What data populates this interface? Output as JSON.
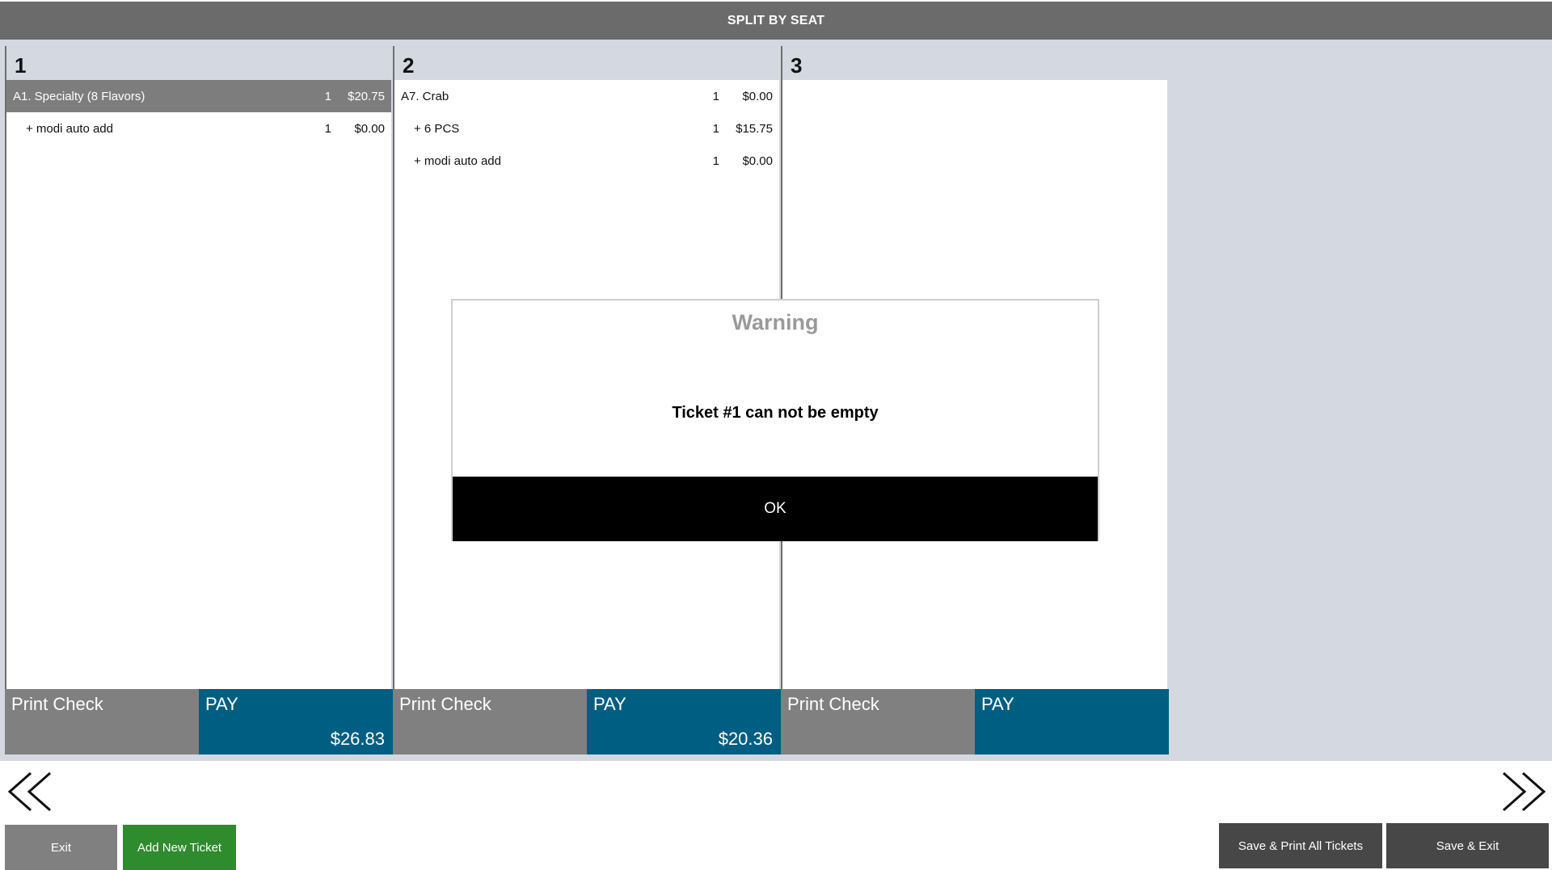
{
  "header": {
    "title": "SPLIT BY SEAT"
  },
  "tickets": [
    {
      "number": "1",
      "items": [
        {
          "name": "A1. Specialty (8 Flavors)",
          "qty": "1",
          "price": "$20.75",
          "selected": true,
          "modifier": false
        },
        {
          "name": "+ modi auto add",
          "qty": "1",
          "price": "$0.00",
          "selected": false,
          "modifier": true
        }
      ],
      "print_label": "Print Check",
      "pay_label": "PAY",
      "pay_total": "$26.83"
    },
    {
      "number": "2",
      "items": [
        {
          "name": "A7. Crab",
          "qty": "1",
          "price": "$0.00",
          "selected": false,
          "modifier": false
        },
        {
          "name": "+ 6 PCS",
          "qty": "1",
          "price": "$15.75",
          "selected": false,
          "modifier": true
        },
        {
          "name": "+ modi auto add",
          "qty": "1",
          "price": "$0.00",
          "selected": false,
          "modifier": true
        }
      ],
      "print_label": "Print Check",
      "pay_label": "PAY",
      "pay_total": "$20.36"
    },
    {
      "number": "3",
      "items": [],
      "print_label": "Print Check",
      "pay_label": "PAY",
      "pay_total": ""
    }
  ],
  "navigation": {
    "prev_icon": "double-chevron-left-icon",
    "next_icon": "double-chevron-right-icon"
  },
  "footer": {
    "exit_label": "Exit",
    "add_ticket_label": "Add New Ticket",
    "save_print_label": "Save & Print All Tickets",
    "save_exit_label": "Save & Exit"
  },
  "dialog": {
    "title": "Warning",
    "message": "Ticket #1 can not be empty",
    "ok_label": "OK"
  },
  "colors": {
    "header_bg": "#6b6b6b",
    "pay_button": "#005e82",
    "print_button": "#808080",
    "add_ticket_button": "#2e8b2e",
    "dark_button": "#474747",
    "selected_row": "#7d7d7d"
  }
}
